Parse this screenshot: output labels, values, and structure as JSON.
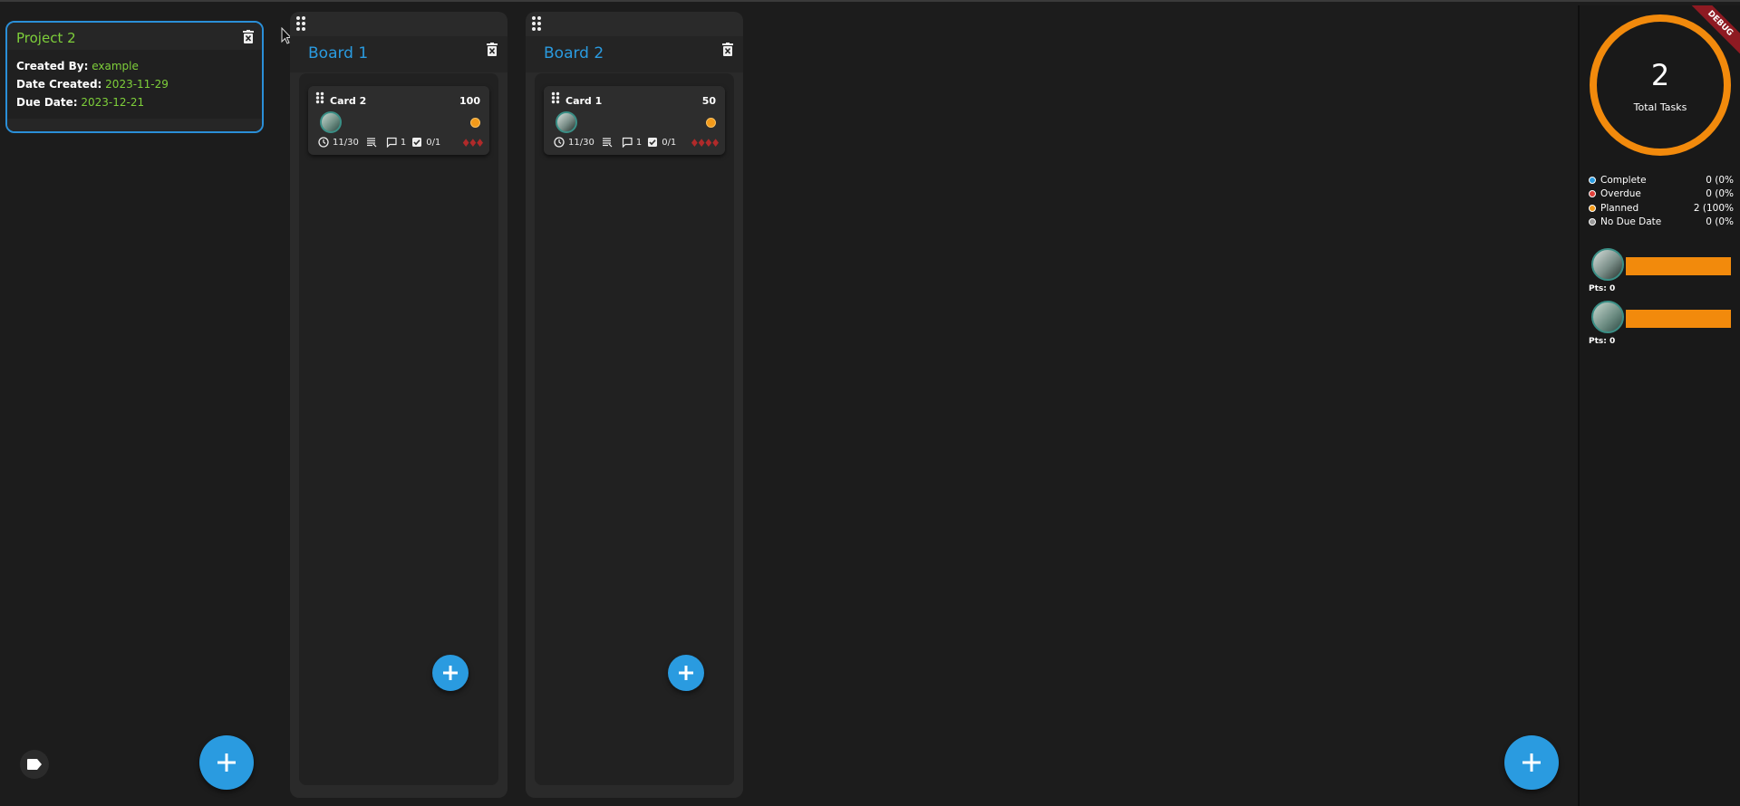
{
  "project": {
    "title": "Project 2",
    "created_by_label": "Created By:",
    "created_by": "example",
    "date_created_label": "Date Created:",
    "date_created": "2023-11-29",
    "due_date_label": "Due Date:",
    "due_date": "2023-12-21"
  },
  "boards": [
    {
      "title": "Board 1",
      "card": {
        "title": "Card 2",
        "points": "100",
        "due": "11/30",
        "comments": "1",
        "checklist": "0/1"
      }
    },
    {
      "title": "Board 2",
      "card": {
        "title": "Card 1",
        "points": "50",
        "due": "11/30",
        "comments": "1",
        "checklist": "0/1"
      }
    }
  ],
  "stats": {
    "debug_label": "DEBUG",
    "total": "2",
    "total_label": "Total Tasks",
    "legend": [
      {
        "label": "Complete",
        "value": "0 (0%",
        "color": "#2a9be0"
      },
      {
        "label": "Overdue",
        "value": "0 (0%",
        "color": "#e0403a"
      },
      {
        "label": "Planned",
        "value": "2 (100%",
        "color": "#f29a1a"
      },
      {
        "label": "No Due Date",
        "value": "0 (0%",
        "color": "#9a9a9a"
      }
    ],
    "users": [
      {
        "points_label": "Pts: 0"
      },
      {
        "points_label": "Pts: 0"
      }
    ]
  },
  "colors": {
    "accent": "#2a9be0",
    "project_text": "#7ecf3a",
    "planned": "#f28a0c"
  }
}
